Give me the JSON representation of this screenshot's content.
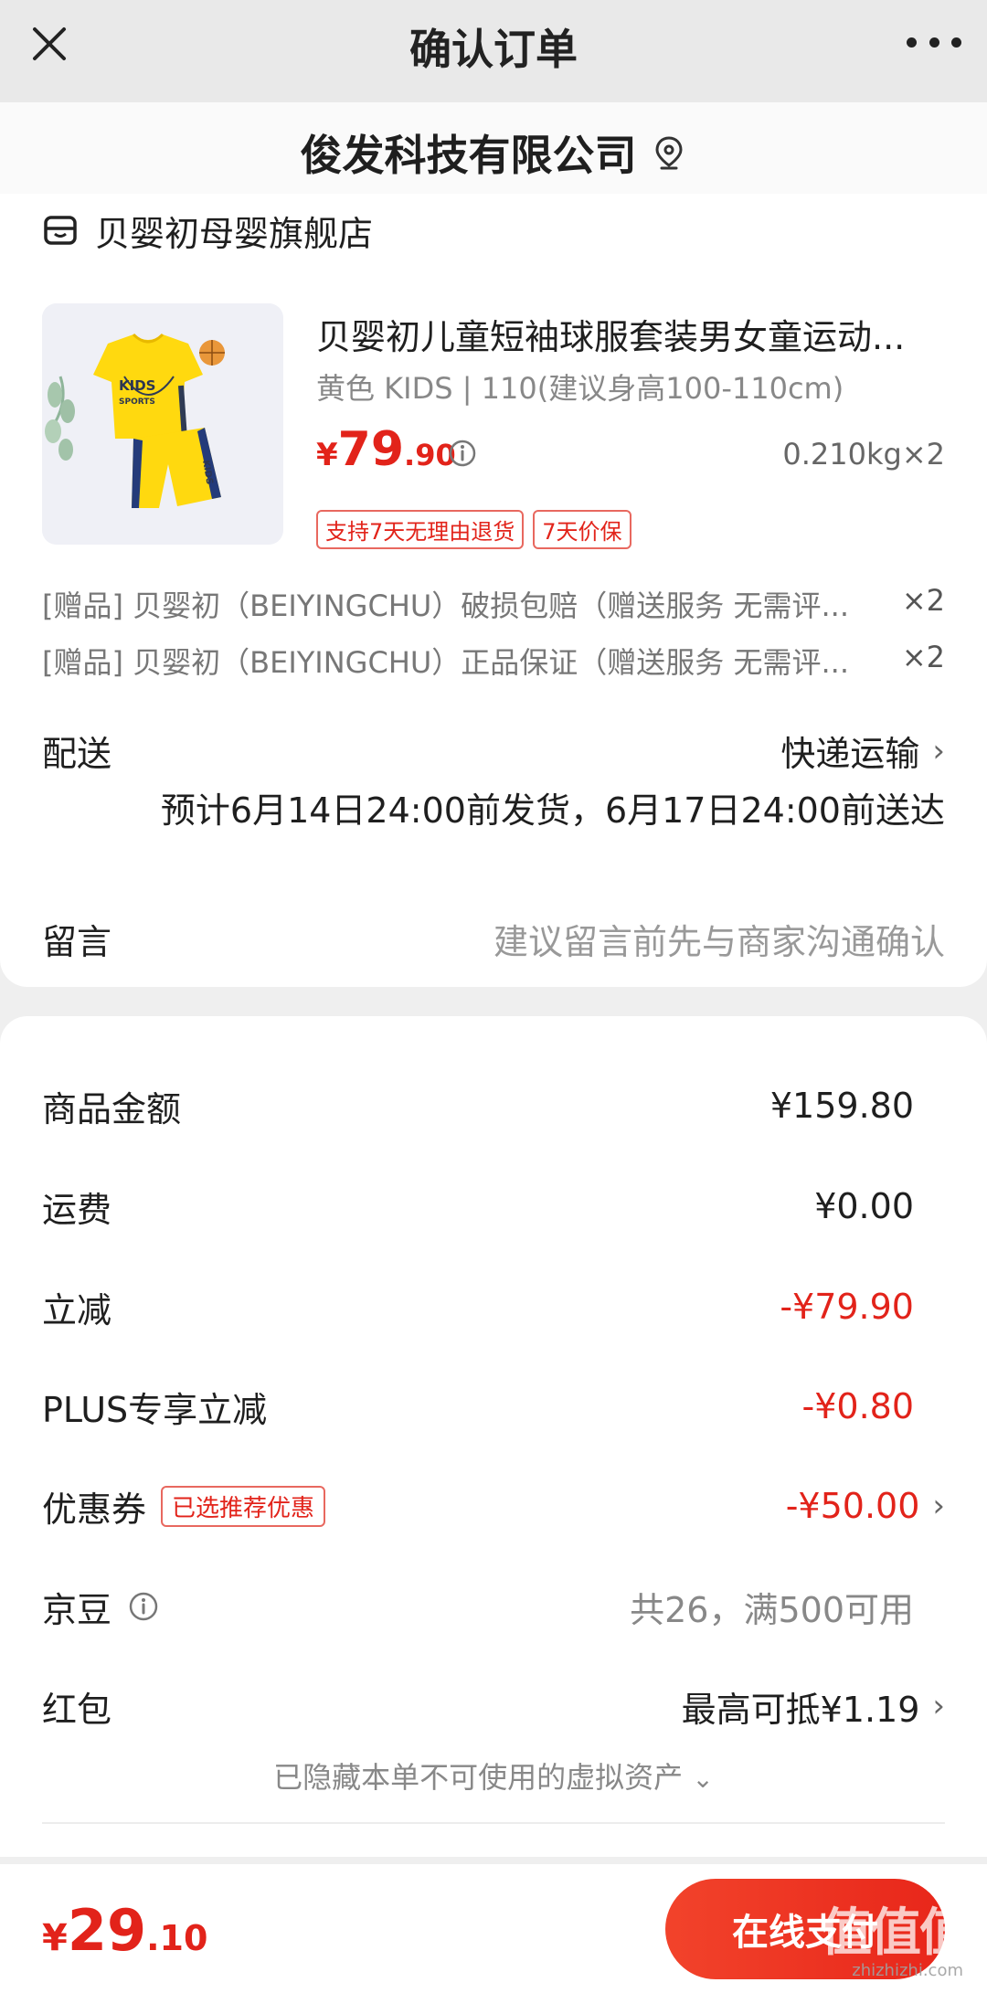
{
  "header": {
    "title": "确认订单"
  },
  "address": {
    "name": "俊发科技有限公司"
  },
  "shop": {
    "name": "贝婴初母婴旗舰店"
  },
  "product": {
    "title": "贝婴初儿童短袖球服套装男女童运动...",
    "spec": "黄色 KIDS | 110(建议身高100-110cm)",
    "price_currency": "¥",
    "price_int": "79",
    "price_dec": ".90",
    "weight_qty": "0.210kg×2",
    "tags": [
      "支持7天无理由退货",
      "7天价保"
    ],
    "image_text": [
      "KIDS",
      "SPORTS",
      "KIDS"
    ]
  },
  "gifts": [
    {
      "text": "[赠品] 贝婴初（BEIYINGCHU）破损包赔（赠送服务 无需评...",
      "qty": "×2"
    },
    {
      "text": "[赠品] 贝婴初（BEIYINGCHU）正品保证（赠送服务 无需评...",
      "qty": "×2"
    }
  ],
  "delivery": {
    "label": "配送",
    "method": "快递运输",
    "eta": "预计6月14日24:00前发货，6月17日24:00前送达"
  },
  "message": {
    "label": "留言",
    "placeholder": "建议留言前先与商家沟通确认"
  },
  "summary": {
    "goods_label": "商品金额",
    "goods_value": "¥159.80",
    "shipping_label": "运费",
    "shipping_value": "¥0.00",
    "discount_label": "立减",
    "discount_value": "-¥79.90",
    "plus_label": "PLUS专享立减",
    "plus_value": "-¥0.80",
    "coupon_label": "优惠券",
    "coupon_badge": "已选推荐优惠",
    "coupon_value": "-¥50.00",
    "beans_label": "京豆",
    "beans_value": "共26，满500可用",
    "redpacket_label": "红包",
    "redpacket_value": "最高可抵¥1.19",
    "hidden_assets": "已隐藏本单不可使用的虚拟资产"
  },
  "footer": {
    "total_currency": "¥",
    "total_int": "29",
    "total_dec": ".10",
    "pay_label": "在线支付",
    "watermark": "值值值",
    "watermark_url": "zhizhizhi.com"
  },
  "colors": {
    "accent": "#e2231a",
    "background": "#efefef"
  }
}
